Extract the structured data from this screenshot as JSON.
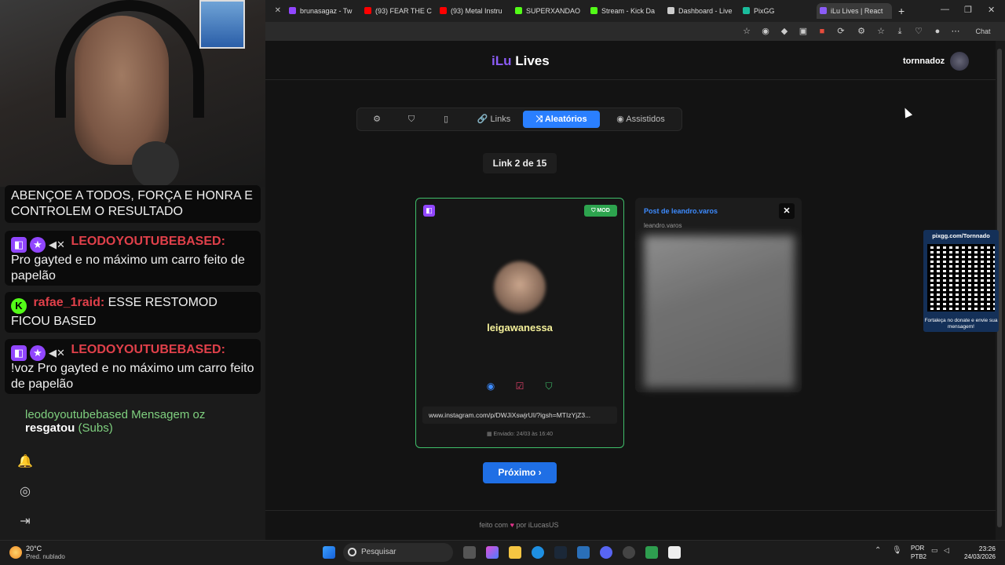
{
  "stream": {
    "caption": "ABENÇOE A TODOS, FORÇA E HONRA E CONTROLEM O RESULTADO",
    "chat": [
      {
        "user": "LEODOYOUTUBEBASED:",
        "message": "Pro gayted e no máximo um carro feito de papelão"
      },
      {
        "user": "rafae_1raid:",
        "message": "ESSE RESTOMOD FICOU BASED"
      },
      {
        "user": "LEODOYOUTUBEBASED:",
        "message": "!voz Pro gayted e no máximo um carro feito de papelão"
      }
    ],
    "redeem_scrambled": "leodoyoutubebased Mensagem oz",
    "redeem_action": "resgatou",
    "redeem_tail": "(Subs)"
  },
  "browser": {
    "tabs": [
      {
        "title": "brunasagaz - Tw",
        "color": "#9146ff"
      },
      {
        "title": "(93) FEAR THE C",
        "color": "#ff0000"
      },
      {
        "title": "(93) Metal Instru",
        "color": "#ff0000"
      },
      {
        "title": "SUPERXANDAO",
        "color": "#53fc18"
      },
      {
        "title": "Stream - Kick Da",
        "color": "#53fc18"
      },
      {
        "title": "Dashboard - Live",
        "color": "#cccccc"
      },
      {
        "title": "PixGG",
        "color": "#1abc9c"
      },
      {
        "title": "iLu Lives | React",
        "color": "#8b5cf6"
      }
    ],
    "chat_label": "Chat"
  },
  "app": {
    "logo_prefix": "iLu",
    "logo_suffix": " Lives",
    "username": "tornnadoz",
    "nav": {
      "links": "Links",
      "random": "Aleatórios",
      "watched": "Assistidos"
    },
    "counter": "Link 2 de 15",
    "card": {
      "mod_badge": "MOD",
      "username": "leigawanessa",
      "url": "www.instagram.com/p/DWJiXswjrUI/?igsh=MTIzYjZ3...",
      "sent": "Enviado: 24/03 às 16:40"
    },
    "preview": {
      "title": "Post de leandro.varos",
      "subtitle": "leandro.varos"
    },
    "next_button": "Próximo ›",
    "footer_prefix": "feito com",
    "footer_suffix": "por iLucasUS"
  },
  "pixgg": {
    "title": "pixgg.com/Tornnado",
    "note": "Fortaleça no donate e envie sua mensagem!"
  },
  "taskbar": {
    "temperature": "20°C",
    "weather": "Pred. nublado",
    "search_placeholder": "Pesquisar",
    "lang1": "POR",
    "lang2": "PTB2",
    "time": "23:26",
    "date": "24/03/2026"
  }
}
